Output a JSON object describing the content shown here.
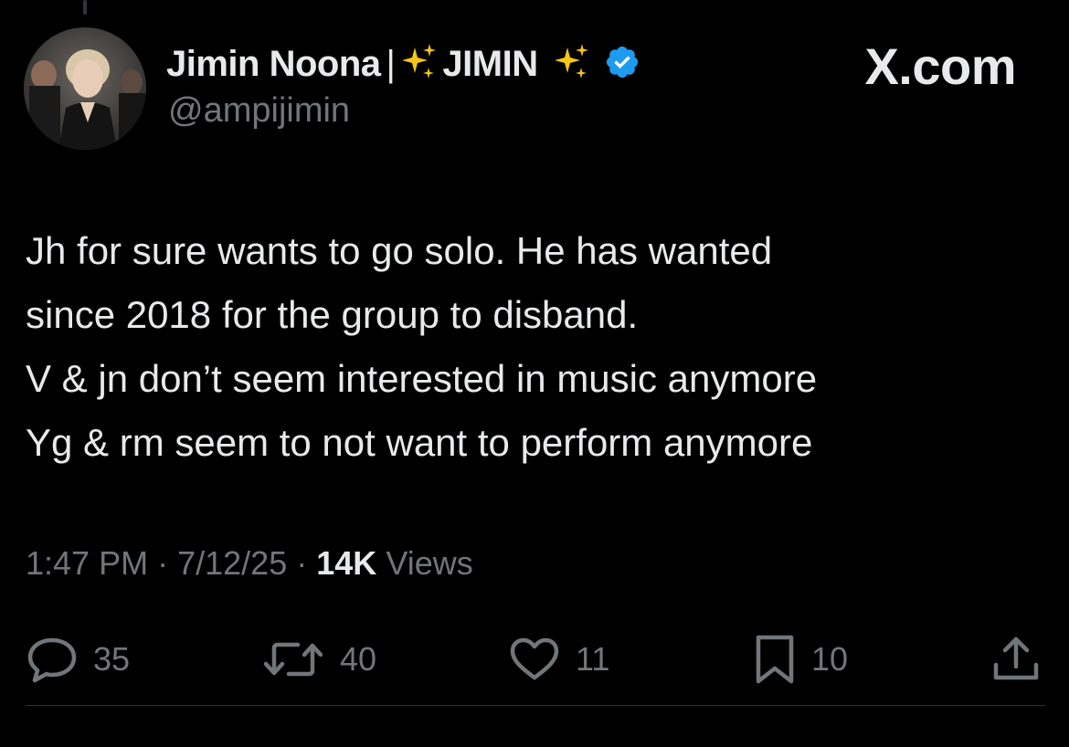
{
  "author": {
    "display_name": "Jimin Noona",
    "separator": "|",
    "name_suffix": "JIMIN",
    "handle": "@ampijimin",
    "verified": true,
    "verified_color": "#1d9bf0"
  },
  "brand": "X.com",
  "tweet": {
    "lines": [
      "Jh for sure wants to go solo. He has wanted",
      "since 2018 for the group to disband.",
      "V & jn don’t seem interested in music anymore",
      "Yg & rm seem to not want to perform anymore"
    ]
  },
  "meta": {
    "time": "1:47 PM",
    "dot": "·",
    "date": "7/12/25",
    "views_count": "14K",
    "views_label": "Views"
  },
  "actions": {
    "replies": "35",
    "reposts": "40",
    "likes": "11",
    "bookmarks": "10"
  },
  "icons": {
    "reply": "reply-icon",
    "repost": "repost-icon",
    "like": "heart-icon",
    "bookmark": "bookmark-icon",
    "share": "share-icon",
    "sparkle": "sparkles-icon",
    "verified": "verified-badge-icon"
  },
  "colors": {
    "background": "#000000",
    "text": "#e7e9ea",
    "secondary": "#71767b",
    "sparkle": "#f5c518"
  }
}
